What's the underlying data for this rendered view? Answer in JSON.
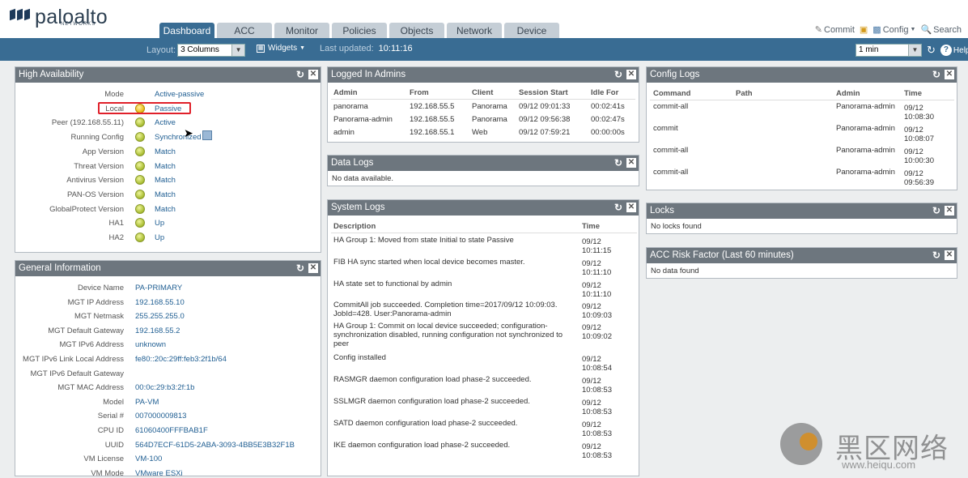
{
  "brand": {
    "name": "paloalto",
    "sub": "NETWORKS"
  },
  "tabs": [
    "Dashboard",
    "ACC",
    "Monitor",
    "Policies",
    "Objects",
    "Network",
    "Device"
  ],
  "top_links": {
    "commit": "Commit",
    "config": "Config",
    "search": "Search"
  },
  "toolbar": {
    "layout_label": "Layout:",
    "layout_value": "3 Columns",
    "widgets": "Widgets",
    "last_updated_label": "Last updated:",
    "last_updated": "10:11:16",
    "refresh_value": "1 min",
    "help": "Help"
  },
  "ha": {
    "title": "High Availability",
    "rows": [
      {
        "k": "Mode",
        "v": "Active-passive",
        "dot": ""
      },
      {
        "k": "Local",
        "v": "Passive",
        "dot": "yellow"
      },
      {
        "k": "Peer (192.168.55.11)",
        "v": "Active",
        "dot": "green"
      },
      {
        "k": "Running Config",
        "v": "Synchronized",
        "dot": "green"
      },
      {
        "k": "App Version",
        "v": "Match",
        "dot": "green"
      },
      {
        "k": "Threat Version",
        "v": "Match",
        "dot": "green"
      },
      {
        "k": "Antivirus Version",
        "v": "Match",
        "dot": "green"
      },
      {
        "k": "PAN-OS Version",
        "v": "Match",
        "dot": "green"
      },
      {
        "k": "GlobalProtect Version",
        "v": "Match",
        "dot": "green"
      },
      {
        "k": "HA1",
        "v": "Up",
        "dot": "green"
      },
      {
        "k": "HA2",
        "v": "Up",
        "dot": "green"
      }
    ]
  },
  "general": {
    "title": "General Information",
    "rows": [
      {
        "k": "Device Name",
        "v": "PA-PRIMARY"
      },
      {
        "k": "MGT IP Address",
        "v": "192.168.55.10"
      },
      {
        "k": "MGT Netmask",
        "v": "255.255.255.0"
      },
      {
        "k": "MGT Default Gateway",
        "v": "192.168.55.2"
      },
      {
        "k": "MGT IPv6 Address",
        "v": "unknown"
      },
      {
        "k": "MGT IPv6 Link Local Address",
        "v": "fe80::20c:29ff:feb3:2f1b/64"
      },
      {
        "k": "MGT IPv6 Default Gateway",
        "v": ""
      },
      {
        "k": "MGT MAC Address",
        "v": "00:0c:29:b3:2f:1b"
      },
      {
        "k": "Model",
        "v": "PA-VM"
      },
      {
        "k": "Serial #",
        "v": "007000009813"
      },
      {
        "k": "CPU ID",
        "v": "61060400FFFBAB1F"
      },
      {
        "k": "UUID",
        "v": "564D7ECF-61D5-2ABA-3093-4BB5E3B32F1B"
      },
      {
        "k": "VM License",
        "v": "VM-100"
      },
      {
        "k": "VM Mode",
        "v": "VMware ESXi"
      }
    ]
  },
  "admins": {
    "title": "Logged In Admins",
    "headers": [
      "Admin",
      "From",
      "Client",
      "Session Start",
      "Idle For"
    ],
    "rows": [
      [
        "panorama",
        "192.168.55.5",
        "Panorama",
        "09/12 09:01:33",
        "00:02:41s"
      ],
      [
        "Panorama-admin",
        "192.168.55.5",
        "Panorama",
        "09/12 09:56:38",
        "00:02:47s"
      ],
      [
        "admin",
        "192.168.55.1",
        "Web",
        "09/12 07:59:21",
        "00:00:00s"
      ]
    ]
  },
  "datalogs": {
    "title": "Data Logs",
    "empty": "No data available."
  },
  "syslogs": {
    "title": "System Logs",
    "headers": [
      "Description",
      "Time"
    ],
    "rows": [
      {
        "d": "HA Group 1: Moved from state Initial to state Passive",
        "t1": "09/12",
        "t2": "10:11:15"
      },
      {
        "d": "FIB HA sync started when local device becomes master.",
        "t1": "09/12",
        "t2": "10:11:10"
      },
      {
        "d": "HA state set to functional by admin",
        "t1": "09/12",
        "t2": "10:11:10"
      },
      {
        "d": "CommitAll job succeeded. Completion time=2017/09/12 10:09:03. JobId=428. User:Panorama-admin",
        "t1": "09/12",
        "t2": "10:09:03"
      },
      {
        "d": "HA Group 1: Commit on local device succeeded; configuration-synchronization disabled, running configuration not synchronized to peer",
        "t1": "09/12",
        "t2": "10:09:02"
      },
      {
        "d": "Config installed",
        "t1": "09/12",
        "t2": "10:08:54"
      },
      {
        "d": "RASMGR daemon configuration load phase-2 succeeded.",
        "t1": "09/12",
        "t2": "10:08:53"
      },
      {
        "d": "SSLMGR daemon configuration load phase-2 succeeded.",
        "t1": "09/12",
        "t2": "10:08:53"
      },
      {
        "d": "SATD daemon configuration load phase-2 succeeded.",
        "t1": "09/12",
        "t2": "10:08:53"
      },
      {
        "d": "IKE daemon configuration load phase-2 succeeded.",
        "t1": "09/12",
        "t2": "10:08:53"
      }
    ]
  },
  "configlogs": {
    "title": "Config Logs",
    "headers": [
      "Command",
      "Path",
      "Admin",
      "Time"
    ],
    "rows": [
      {
        "c": "commit-all",
        "p": "",
        "a": "Panorama-admin",
        "t1": "09/12",
        "t2": "10:08:30"
      },
      {
        "c": "commit",
        "p": "",
        "a": "Panorama-admin",
        "t1": "09/12",
        "t2": "10:08:07"
      },
      {
        "c": "commit-all",
        "p": "",
        "a": "Panorama-admin",
        "t1": "09/12",
        "t2": "10:00:30"
      },
      {
        "c": "commit-all",
        "p": "",
        "a": "Panorama-admin",
        "t1": "09/12",
        "t2": "09:56:39"
      }
    ]
  },
  "locks": {
    "title": "Locks",
    "empty": "No locks found"
  },
  "acc": {
    "title": "ACC Risk Factor (Last 60 minutes)",
    "empty": "No data found"
  },
  "watermark": {
    "text": "黑区网络",
    "url": "www.heiqu.com"
  },
  "colors": {
    "accent": "#396c93",
    "panel_header": "#6d767e",
    "link": "#1f5e92",
    "highlight_box": "#e0202a"
  }
}
